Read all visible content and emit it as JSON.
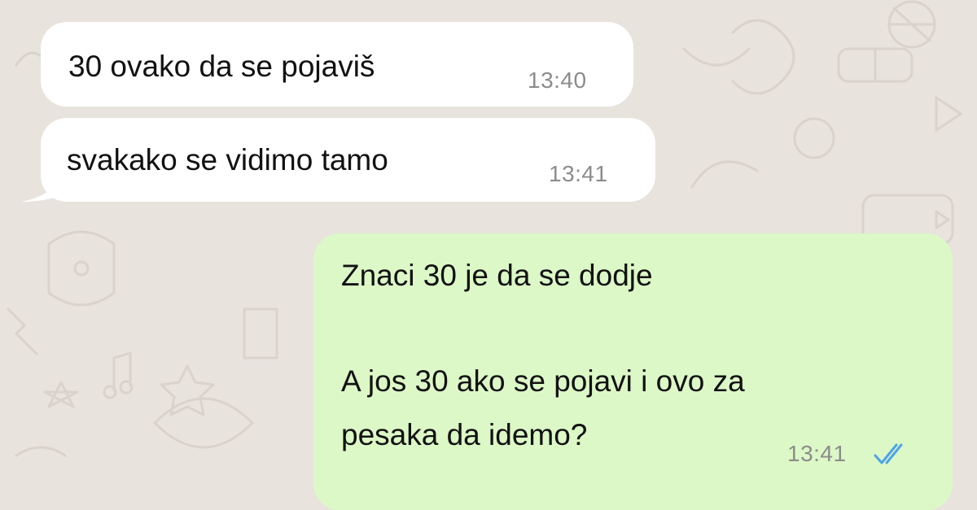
{
  "chat": {
    "messages": [
      {
        "direction": "incoming",
        "text": "30 ovako da se pojaviš",
        "time": "13:40"
      },
      {
        "direction": "incoming",
        "text": "svakako se vidimo tamo",
        "time": "13:41"
      },
      {
        "direction": "outgoing",
        "lines": [
          "Znaci 30 je da se dodje",
          "",
          "A jos 30 ako se pojavi i ovo za",
          "pesaka da idemo?"
        ],
        "time": "13:41",
        "status": "read",
        "status_icon": "double-check-icon"
      }
    ]
  },
  "colors": {
    "background": "#e8e3dd",
    "incoming_bubble": "#ffffff",
    "outgoing_bubble": "#dcf8c6",
    "timestamp": "#8c8c8c",
    "read_ticks": "#4fa3e8"
  }
}
